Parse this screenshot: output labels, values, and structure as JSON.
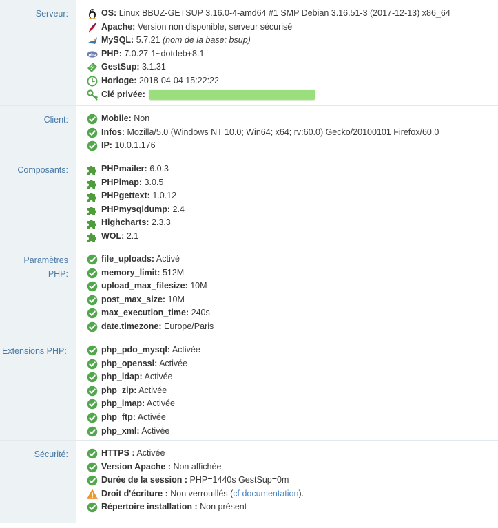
{
  "sections": {
    "server": {
      "label": "Serveur:",
      "os": {
        "key": "OS:",
        "value": "Linux BBUZ-GETSUP 3.16.0-4-amd64 #1 SMP Debian 3.16.51-3 (2017-12-13) x86_64"
      },
      "apache": {
        "key": "Apache:",
        "value": "Version non disponible, serveur sécurisé"
      },
      "mysql": {
        "key": "MySQL:",
        "value": "5.7.21",
        "note": "(nom de la base: bsup)"
      },
      "php": {
        "key": "PHP:",
        "value": "7.0.27-1~dotdeb+8.1"
      },
      "gestsup": {
        "key": "GestSup:",
        "value": "3.1.31"
      },
      "clock": {
        "key": "Horloge:",
        "value": "2018-04-04 15:22:22"
      },
      "private_key": {
        "key": "Clé privée:"
      }
    },
    "client": {
      "label": "Client:",
      "mobile": {
        "key": "Mobile:",
        "value": "Non"
      },
      "infos": {
        "key": "Infos:",
        "value": "Mozilla/5.0 (Windows NT 10.0; Win64; x64; rv:60.0) Gecko/20100101 Firefox/60.0"
      },
      "ip": {
        "key": "IP:",
        "value": "10.0.1.176"
      }
    },
    "components": {
      "label": "Composants:",
      "items": [
        {
          "key": "PHPmailer:",
          "value": "6.0.3"
        },
        {
          "key": "PHPimap:",
          "value": "3.0.5"
        },
        {
          "key": "PHPgettext:",
          "value": "1.0.12"
        },
        {
          "key": "PHPmysqldump:",
          "value": "2.4"
        },
        {
          "key": "Highcharts:",
          "value": "2.3.3"
        },
        {
          "key": "WOL:",
          "value": "2.1"
        }
      ]
    },
    "php_params": {
      "label_line1": "Paramètres",
      "label_line2": "PHP:",
      "items": [
        {
          "key": "file_uploads:",
          "value": "Activé"
        },
        {
          "key": "memory_limit:",
          "value": "512M"
        },
        {
          "key": "upload_max_filesize:",
          "value": "10M"
        },
        {
          "key": "post_max_size:",
          "value": "10M"
        },
        {
          "key": "max_execution_time:",
          "value": "240s"
        },
        {
          "key": "date.timezone:",
          "value": "Europe/Paris"
        }
      ]
    },
    "php_extensions": {
      "label": "Extensions PHP:",
      "items": [
        {
          "key": "php_pdo_mysql:",
          "value": "Activée"
        },
        {
          "key": "php_openssl:",
          "value": "Activée"
        },
        {
          "key": "php_ldap:",
          "value": "Activée"
        },
        {
          "key": "php_zip:",
          "value": "Activée"
        },
        {
          "key": "php_imap:",
          "value": "Activée"
        },
        {
          "key": "php_ftp:",
          "value": "Activée"
        },
        {
          "key": "php_xml:",
          "value": "Activée"
        }
      ]
    },
    "security": {
      "label": "Sécurité:",
      "https": {
        "key": "HTTPS :",
        "value": "Activée"
      },
      "apache_version": {
        "key": "Version Apache :",
        "value": "Non affichée"
      },
      "session": {
        "key": "Durée de la session :",
        "value": "PHP=1440s GestSup=0m"
      },
      "write_right": {
        "key": "Droit d'écriture :",
        "value_before": "Non verrouillés (",
        "link": "cf documentation",
        "value_after": ")."
      },
      "install_dir": {
        "key": "Répertoire installation :",
        "value": "Non présent"
      }
    }
  },
  "colors": {
    "label": "#4a7aa8",
    "label_bg": "#edf3f4",
    "ok": "#52a64c",
    "warn": "#f09a2a",
    "link": "#4a85c4",
    "key_mask": "#9ade7e"
  }
}
